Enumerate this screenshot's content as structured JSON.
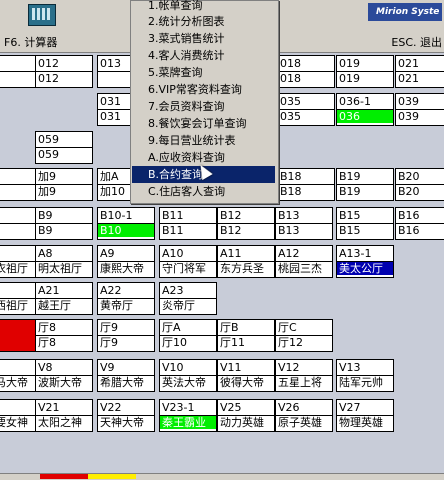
{
  "toolbar": {
    "calc_label": "F6. 计算器",
    "esc_label": "ESC. 退出",
    "logo_text": "Mirion Syste"
  },
  "menu": {
    "items": [
      "1.帐单查询",
      "2.统计分析图表",
      "3.菜式销售统计",
      "4.客人消费统计",
      "5.菜牌查询",
      "6.VIP常客资料查询",
      "7.会员资料查询",
      "8.餐饮宴会订单查询",
      "9.每日营业统计表",
      "A.应收资料查询",
      "B.合约查询",
      "C.住店客人查询"
    ],
    "selected_index": 10
  },
  "rooms": [
    [
      "",
      "",
      ""
    ],
    [
      "012",
      "012",
      ""
    ],
    [
      "013",
      "",
      ""
    ],
    [
      "018",
      "018",
      ""
    ],
    [
      "019",
      "019",
      ""
    ],
    [
      "021",
      "021",
      ""
    ],
    [
      "031",
      "031",
      ""
    ],
    [
      "035",
      "035",
      ""
    ],
    [
      "036-1",
      "036",
      "green"
    ],
    [
      "039",
      "039",
      ""
    ],
    [
      "059",
      "059",
      ""
    ],
    [
      "",
      "",
      ""
    ],
    [
      "加9",
      "加9",
      ""
    ],
    [
      "加A",
      "加10",
      ""
    ],
    [
      "B18",
      "B18",
      ""
    ],
    [
      "B19",
      "B19",
      ""
    ],
    [
      "B20",
      "B20",
      ""
    ],
    [
      "",
      "",
      ""
    ],
    [
      "B9",
      "B9",
      ""
    ],
    [
      "B10-1",
      "B10",
      "green"
    ],
    [
      "B11",
      "B11",
      ""
    ],
    [
      "B12",
      "B12",
      ""
    ],
    [
      "B13",
      "B13",
      ""
    ],
    [
      "B15",
      "B15",
      ""
    ],
    [
      "B16",
      "B16",
      ""
    ],
    [
      "",
      "衣祖厅",
      ""
    ],
    [
      "A8",
      "明太祖厅",
      ""
    ],
    [
      "A9",
      "康熙大帝",
      ""
    ],
    [
      "A10",
      "守门将军",
      ""
    ],
    [
      "A11",
      "东方兵圣",
      ""
    ],
    [
      "A12",
      "桃园三杰",
      ""
    ],
    [
      "A13-1",
      "美太公厅",
      "blue"
    ],
    [
      "",
      "西祖厅",
      ""
    ],
    [
      "A21",
      "越王厅",
      ""
    ],
    [
      "A22",
      "黄帝厅",
      ""
    ],
    [
      "A23",
      "炎帝厅",
      ""
    ],
    [
      "",
      "",
      "red"
    ],
    [
      "厅8",
      "厅8",
      ""
    ],
    [
      "厅9",
      "厅9",
      ""
    ],
    [
      "厅A",
      "厅10",
      ""
    ],
    [
      "厅B",
      "厅11",
      ""
    ],
    [
      "厅C",
      "厅12",
      ""
    ],
    [
      "",
      "马大帝",
      ""
    ],
    [
      "V8",
      "波斯大帝",
      ""
    ],
    [
      "V9",
      "希腊大帝",
      ""
    ],
    [
      "V10",
      "英法大帝",
      ""
    ],
    [
      "V11",
      "彼得大帝",
      ""
    ],
    [
      "V12",
      "五星上将",
      ""
    ],
    [
      "V13",
      "陆军元帅",
      ""
    ],
    [
      "",
      "要女神",
      ""
    ],
    [
      "V21",
      "太阳之神",
      ""
    ],
    [
      "V22",
      "天神大帝",
      ""
    ],
    [
      "V23-1",
      "秦王霸业",
      "green"
    ],
    [
      "V25",
      "动力英雄",
      ""
    ],
    [
      "V26",
      "原子英雄",
      ""
    ],
    [
      "V27",
      "物理英雄",
      ""
    ]
  ]
}
